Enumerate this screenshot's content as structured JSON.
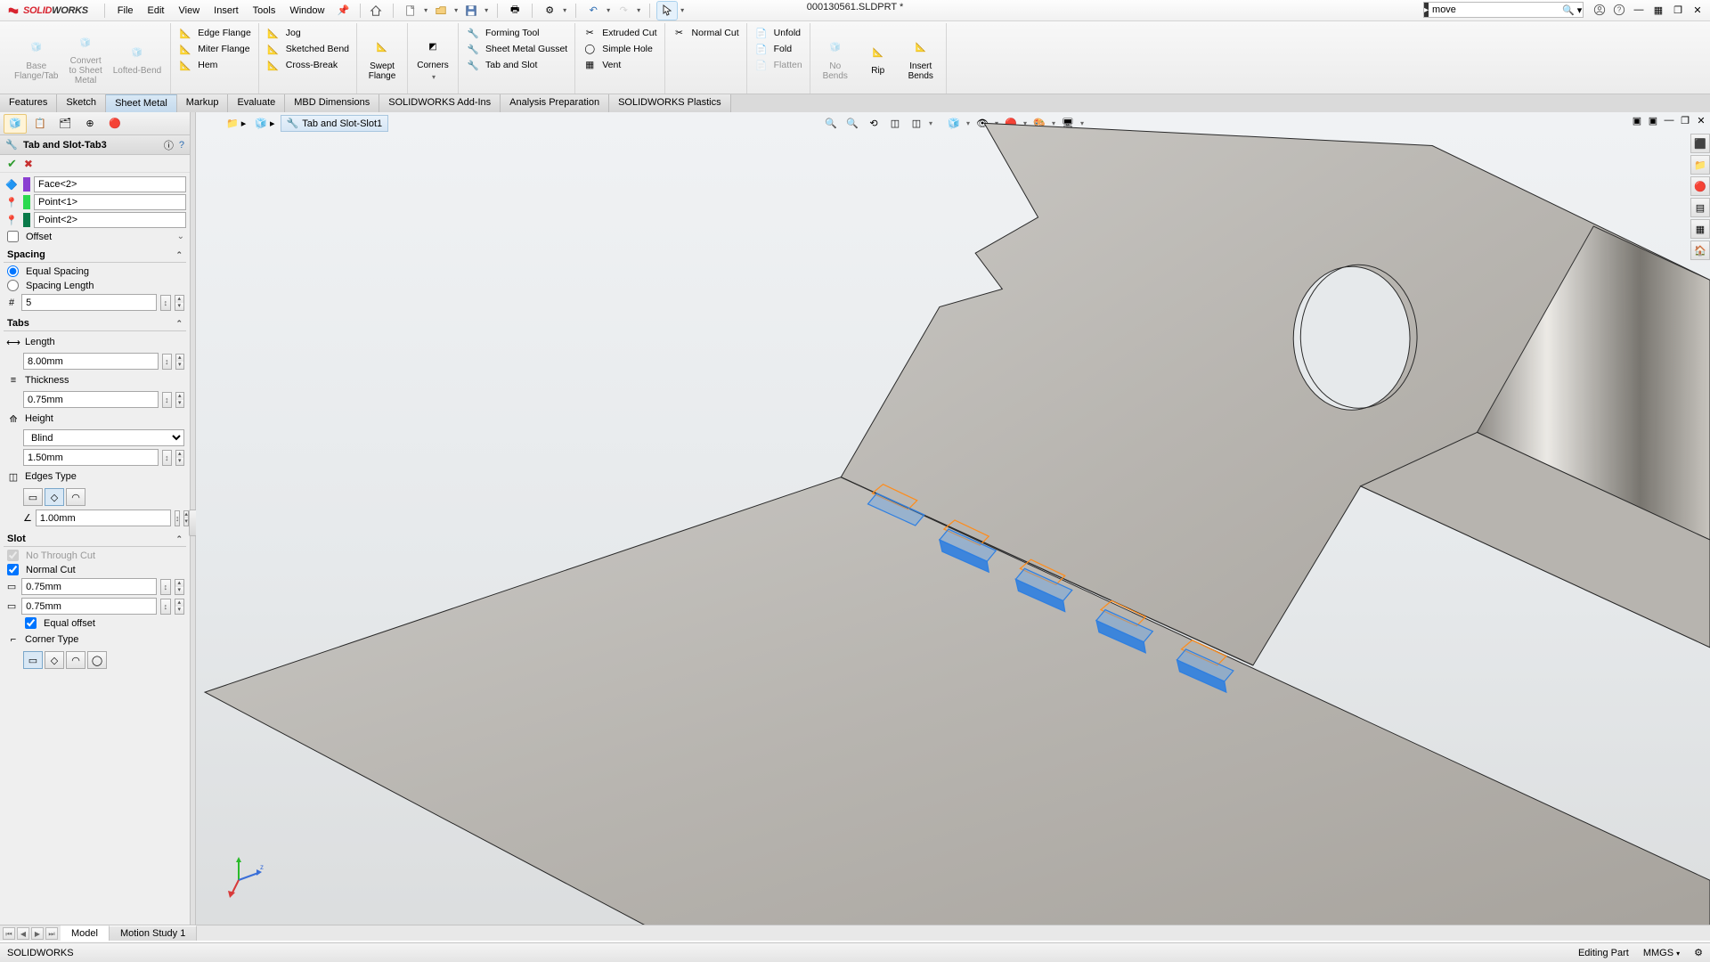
{
  "app": {
    "title": "000130561.SLDPRT *",
    "brand_solid": "SOLID",
    "brand_works": "WORKS"
  },
  "menu": {
    "items": [
      "File",
      "Edit",
      "View",
      "Insert",
      "Tools",
      "Window"
    ]
  },
  "search": {
    "value": "move"
  },
  "ribbon": {
    "disabled_big": [
      {
        "label": "Base\nFlange/Tab"
      },
      {
        "label": "Convert\nto Sheet\nMetal"
      },
      {
        "label": "Lofted-Bend"
      }
    ],
    "col1": [
      "Edge Flange",
      "Miter Flange",
      "Hem"
    ],
    "col2": [
      "Jog",
      "Sketched Bend",
      "Cross-Break"
    ],
    "swept": "Swept\nFlange",
    "corners": "Corners",
    "col3": [
      "Forming Tool",
      "Sheet Metal Gusset",
      "Tab and Slot"
    ],
    "col4": [
      "Extruded Cut",
      "Simple Hole",
      "Vent"
    ],
    "col5": [
      "Normal Cut"
    ],
    "col6": [
      "Unfold",
      "Fold",
      "Flatten"
    ],
    "nobends": "No\nBends",
    "rip": "Rip",
    "insertbends": "Insert\nBends"
  },
  "tabs": [
    "Features",
    "Sketch",
    "Sheet Metal",
    "Markup",
    "Evaluate",
    "MBD Dimensions",
    "SOLIDWORKS Add-Ins",
    "Analysis Preparation",
    "SOLIDWORKS Plastics"
  ],
  "active_tab": "Sheet Metal",
  "breadcrumb": {
    "feature": "Tab and Slot-Slot1"
  },
  "pm": {
    "title": "Tab and Slot-Tab3",
    "selections": [
      {
        "color": "#8a3fd1",
        "value": "Face<2>"
      },
      {
        "color": "#2bd94f",
        "value": "Point<1>"
      },
      {
        "color": "#0a7a4a",
        "value": "Point<2>"
      }
    ],
    "offset_label": "Offset",
    "spacing": {
      "title": "Spacing",
      "equal": "Equal Spacing",
      "length": "Spacing Length",
      "count": "5"
    },
    "tabs_sec": {
      "title": "Tabs",
      "length_label": "Length",
      "length": "8.00mm",
      "thickness_label": "Thickness",
      "thickness": "0.75mm",
      "height_label": "Height",
      "height_type": "Blind",
      "height": "1.50mm",
      "edges_label": "Edges Type",
      "edge_val": "1.00mm"
    },
    "slot": {
      "title": "Slot",
      "no_through": "No Through Cut",
      "normal": "Normal Cut",
      "l": "0.75mm",
      "w": "0.75mm",
      "equal_offset": "Equal offset",
      "corner": "Corner Type"
    }
  },
  "bottom": {
    "model": "Model",
    "study": "Motion Study 1"
  },
  "status": {
    "app": "SOLIDWORKS",
    "mode": "Editing Part",
    "units": "MMGS"
  }
}
